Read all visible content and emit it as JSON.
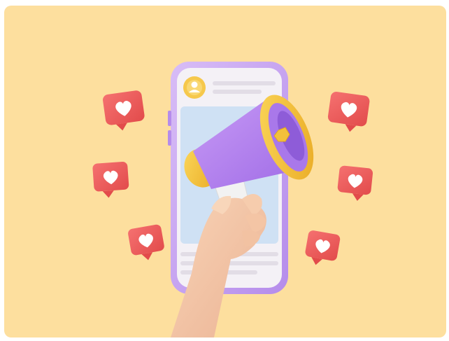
{
  "image": {
    "subject": "3d-hand-holding-megaphone-over-phone-with-heart-like-badges",
    "colors": {
      "background": "#FDDF9E",
      "phone_frame": "#C9A6F2",
      "phone_screen": "#F4F1F6",
      "screen_image": "#CFE1F4",
      "avatar": "#F6C84C",
      "megaphone_body": "#B985F0",
      "megaphone_bell_rim": "#F3C13A",
      "megaphone_handle": "#F1F1F1",
      "badge": "#EF5D5C",
      "heart": "#FFFFFF",
      "skin": "#F4C7A6"
    },
    "icons": [
      "heart-badge-icon",
      "avatar-icon",
      "megaphone-icon"
    ]
  }
}
